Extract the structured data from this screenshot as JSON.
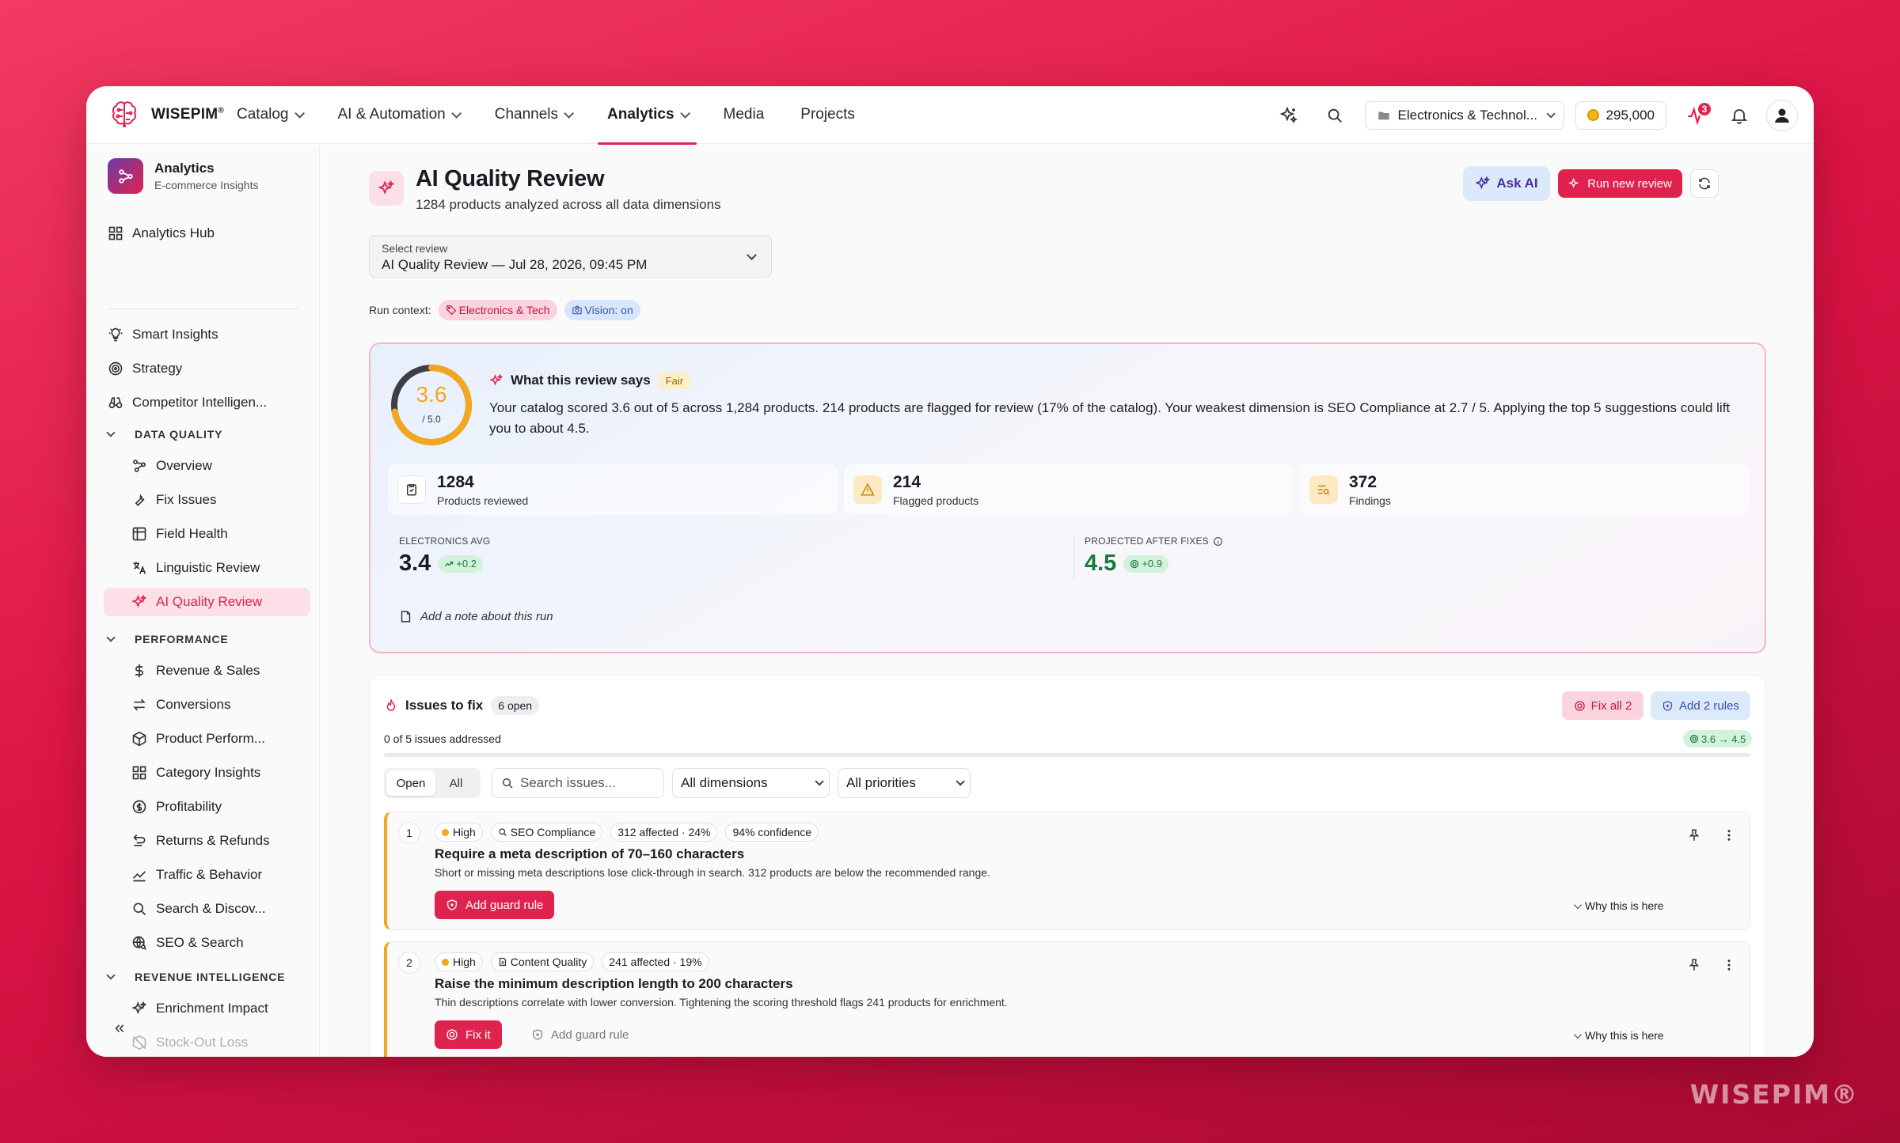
{
  "brand": {
    "name": "WISEPIM",
    "mark": "®"
  },
  "watermark": "WISEPIM®",
  "topnav": {
    "items": [
      {
        "label": "Catalog",
        "dropdown": true
      },
      {
        "label": "AI & Automation",
        "dropdown": true
      },
      {
        "label": "Channels",
        "dropdown": true
      },
      {
        "label": "Analytics",
        "dropdown": true,
        "active": true
      },
      {
        "label": "Media",
        "dropdown": false
      },
      {
        "label": "Projects",
        "dropdown": false
      }
    ],
    "workspace": "Electronics & Technol...",
    "credits": "295,000",
    "activity_count": "3"
  },
  "sidebar": {
    "title": "Analytics",
    "subtitle": "E-commerce Insights",
    "hub": "Analytics Hub",
    "items": [
      "Smart Insights",
      "Strategy",
      "Competitor Intelligen..."
    ],
    "sections": [
      {
        "label": "DATA QUALITY",
        "items": [
          "Overview",
          "Fix Issues",
          "Field Health",
          "Linguistic Review",
          "AI Quality Review"
        ]
      },
      {
        "label": "PERFORMANCE",
        "items": [
          "Revenue & Sales",
          "Conversions",
          "Product Perform...",
          "Category Insights",
          "Profitability",
          "Returns & Refunds",
          "Traffic & Behavior",
          "Search & Discov...",
          "SEO & Search"
        ]
      },
      {
        "label": "REVENUE INTELLIGENCE",
        "items": [
          "Enrichment Impact",
          "Stock-Out Loss"
        ]
      }
    ],
    "collapse": "«"
  },
  "page": {
    "title": "AI Quality Review",
    "subtitle": "1284 products analyzed across all data dimensions",
    "ask_ai": "Ask AI",
    "run_new": "Run new review",
    "select_label": "Select review",
    "select_value": "AI Quality Review — Jul 28, 2026, 09:45 PM",
    "run_context_label": "Run context:",
    "run_context_tags": [
      "Electronics & Tech",
      "Vision: on"
    ]
  },
  "summary": {
    "score": "3.6",
    "score_of": "/ 5.0",
    "score_fraction": 0.72,
    "heading": "What this review says",
    "rating": "Fair",
    "text": "Your catalog scored 3.6 out of 5 across 1,284 products. 214 products are flagged for review (17% of the catalog). Your weakest dimension is SEO Compliance at 2.7 / 5. Applying the top 5 suggestions could lift you to about 4.5.",
    "stats": [
      {
        "value": "1284",
        "label": "Products reviewed"
      },
      {
        "value": "214",
        "label": "Flagged products"
      },
      {
        "value": "372",
        "label": "Findings"
      }
    ],
    "avg_label": "ELECTRONICS AVG",
    "avg_value": "3.4",
    "avg_delta": "+0.2",
    "proj_label": "PROJECTED AFTER FIXES",
    "proj_value": "4.5",
    "proj_delta": "+0.9",
    "note_placeholder": "Add a note about this run"
  },
  "issues": {
    "title": "Issues to fix",
    "open_count": "6 open",
    "fix_all": "Fix all 2",
    "add_rules": "Add 2 rules",
    "addressed": "0 of 5 issues addressed",
    "projection": "3.6 → 4.5",
    "filter_open": "Open",
    "filter_all": "All",
    "search_placeholder": "Search issues...",
    "dimension_select": "All dimensions",
    "priority_select": "All priorities",
    "why": "Why this is here",
    "list": [
      {
        "num": "1",
        "priority": "High",
        "dimension": "SEO Compliance",
        "affected": "312 affected · 24%",
        "confidence": "94% confidence",
        "title": "Require a meta description of 70–160 characters",
        "desc": "Short or missing meta descriptions lose click-through in search. 312 products are below the recommended range.",
        "primary_action": "Add guard rule"
      },
      {
        "num": "2",
        "priority": "High",
        "dimension": "Content Quality",
        "affected": "241 affected · 19%",
        "title": "Raise the minimum description length to 200 characters",
        "desc": "Thin descriptions correlate with lower conversion. Tightening the scoring threshold flags 241 products for enrichment.",
        "primary_action": "Fix it",
        "secondary_action": "Add guard rule"
      }
    ]
  },
  "colors": {
    "accent": "#e0234e",
    "warning": "#f2a81d",
    "success": "#1d7a3d",
    "ai_blue": "#dbe9fb"
  }
}
